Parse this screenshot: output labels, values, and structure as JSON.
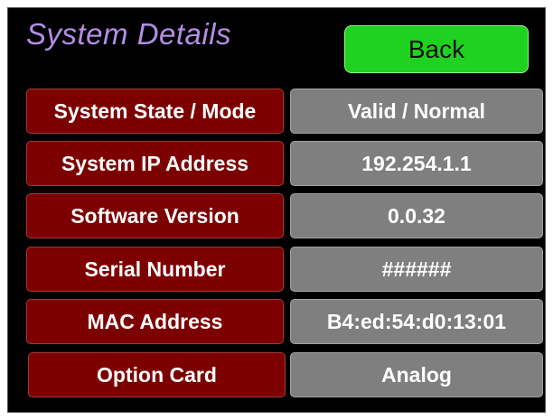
{
  "header": {
    "title": "System Details",
    "back_label": "Back"
  },
  "rows": [
    {
      "label": "System State / Mode",
      "value": "Valid / Normal"
    },
    {
      "label": "System IP Address",
      "value": "192.254.1.1"
    },
    {
      "label": "Software Version",
      "value": "0.0.32"
    },
    {
      "label": "Serial Number",
      "value": "######"
    },
    {
      "label": "MAC Address",
      "value": "B4:ed:54:d0:13:01"
    },
    {
      "label": "Option Card",
      "value": "Analog"
    }
  ],
  "colors": {
    "background": "#000000",
    "title": "#b48ee6",
    "back_button": "#1fd21f",
    "label_cell": "#7d0000",
    "value_cell": "#7f7f7f"
  }
}
